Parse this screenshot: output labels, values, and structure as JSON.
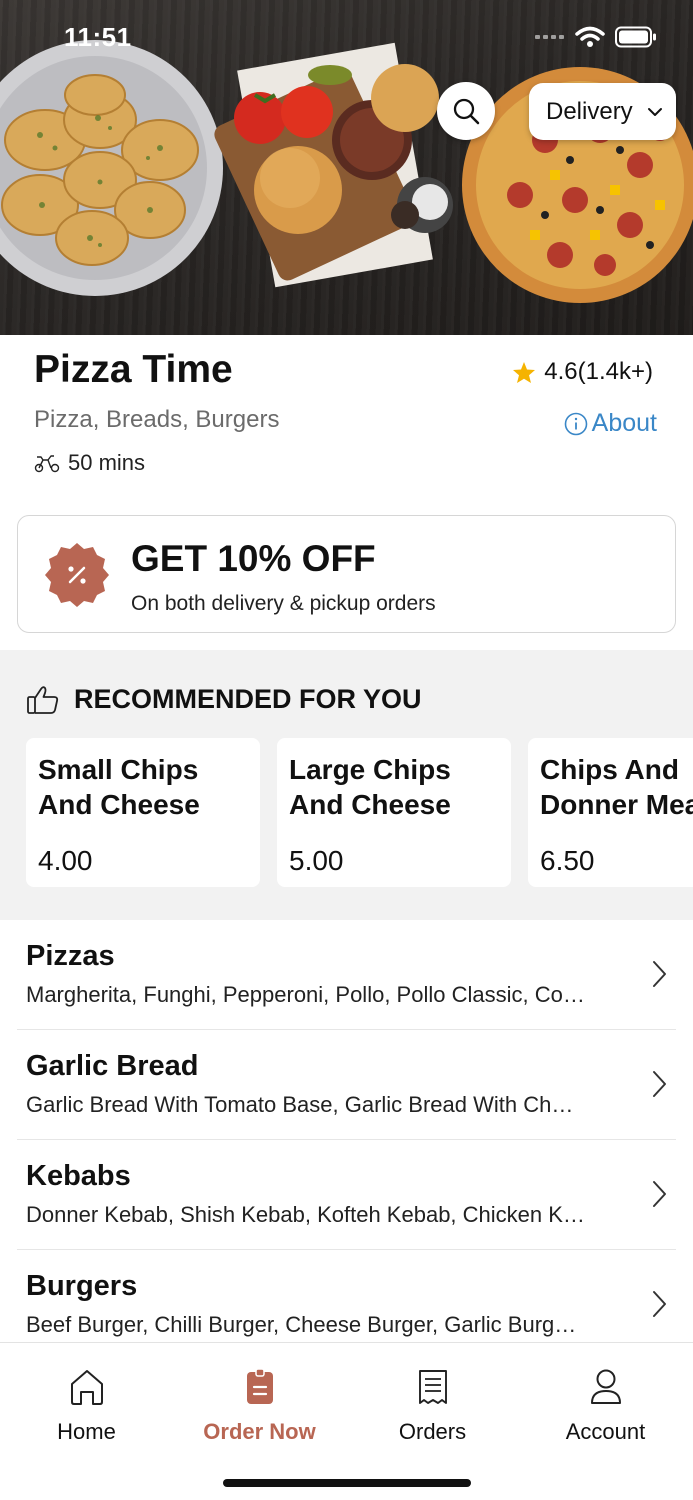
{
  "status_bar": {
    "time": "11:51"
  },
  "header": {
    "mode_selector": {
      "value": "Delivery"
    }
  },
  "restaurant": {
    "name": "Pizza Time",
    "rating": "4.6(1.4k+)",
    "cuisines": "Pizza, Breads, Burgers",
    "about_label": "About",
    "delivery_time": "50 mins"
  },
  "promo": {
    "title": "GET 10% OFF",
    "subtitle": "On both delivery & pickup orders"
  },
  "recommended": {
    "heading": "RECOMMENDED FOR YOU",
    "items": [
      {
        "name_line1": "Small Chips",
        "name_line2": "And Cheese",
        "price": "4.00"
      },
      {
        "name_line1": "Large Chips",
        "name_line2": "And Cheese",
        "price": "5.00"
      },
      {
        "name_line1": "Chips And",
        "name_line2": "Donner Meat",
        "price": "6.50"
      }
    ]
  },
  "menu": [
    {
      "name": "Pizzas",
      "description": "Margherita, Funghi, Pepperoni, Pollo, Pollo Classic, Co…"
    },
    {
      "name": "Garlic Bread",
      "description": "Garlic Bread With Tomato Base, Garlic Bread With Ch…"
    },
    {
      "name": "Kebabs",
      "description": "Donner Kebab, Shish Kebab, Kofteh Kebab, Chicken K…"
    },
    {
      "name": "Burgers",
      "description": "Beef Burger, Chilli Burger, Cheese Burger, Garlic Burg…"
    }
  ],
  "bottom_nav": {
    "active": "Order Now",
    "items": [
      {
        "label": "Home",
        "icon": "home-icon"
      },
      {
        "label": "Order Now",
        "icon": "order-bag-icon"
      },
      {
        "label": "Orders",
        "icon": "receipt-icon"
      },
      {
        "label": "Account",
        "icon": "user-icon"
      }
    ]
  },
  "colors": {
    "accent": "#b86653",
    "link": "#3a87c7",
    "star": "#f5b301",
    "section_bg": "#f2f2f2"
  }
}
